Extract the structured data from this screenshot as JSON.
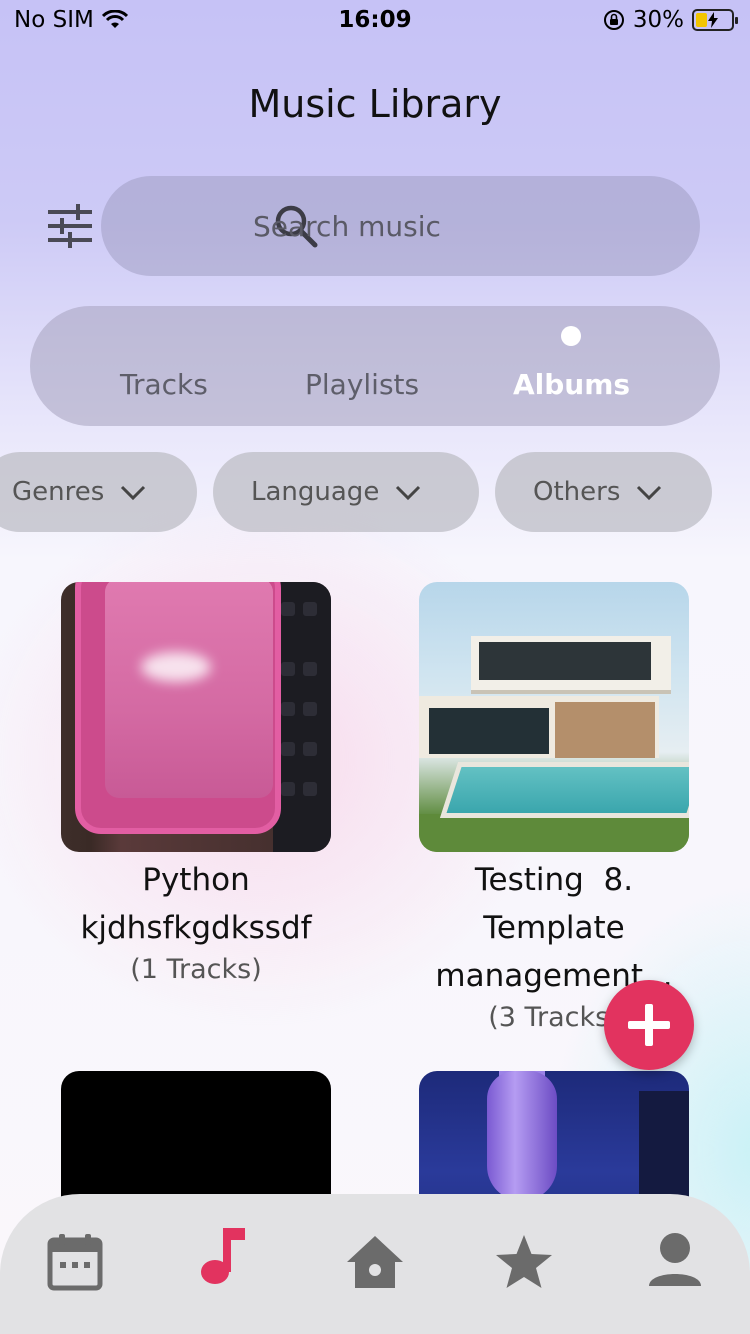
{
  "status_bar": {
    "carrier": "No SIM",
    "time": "16:09",
    "battery_percent": "30%",
    "battery_level": 0.3
  },
  "header": {
    "title": "Music Library"
  },
  "search": {
    "placeholder": "Search music"
  },
  "tabs": [
    {
      "label": "Tracks",
      "active": false
    },
    {
      "label": "Playlists",
      "active": false
    },
    {
      "label": "Albums",
      "active": true
    }
  ],
  "filters": [
    {
      "label": "Genres"
    },
    {
      "label": "Language"
    },
    {
      "label": "Others"
    }
  ],
  "albums": [
    {
      "title_line1": "Python",
      "title_line2": "kjdhsfkgdkssdf",
      "title_line3": "",
      "track_count": "(1 Tracks)"
    },
    {
      "title_line1": "Testing  8.",
      "title_line2": "Template",
      "title_line3": "management...",
      "track_count": "(3 Tracks)"
    },
    {
      "title_line1": "",
      "title_line2": "",
      "title_line3": "",
      "track_count": ""
    },
    {
      "title_line1": "",
      "title_line2": "",
      "title_line3": "",
      "track_count": ""
    }
  ],
  "bottom_nav": {
    "items": [
      {
        "icon": "calendar-icon",
        "active": false
      },
      {
        "icon": "music-note-icon",
        "active": true
      },
      {
        "icon": "home-icon",
        "active": false
      },
      {
        "icon": "star-icon",
        "active": false
      },
      {
        "icon": "profile-icon",
        "active": false
      }
    ]
  },
  "colors": {
    "accent": "#e2335f",
    "inactive_icon": "#6b6b6b",
    "active_tab_text": "#ffffff"
  }
}
